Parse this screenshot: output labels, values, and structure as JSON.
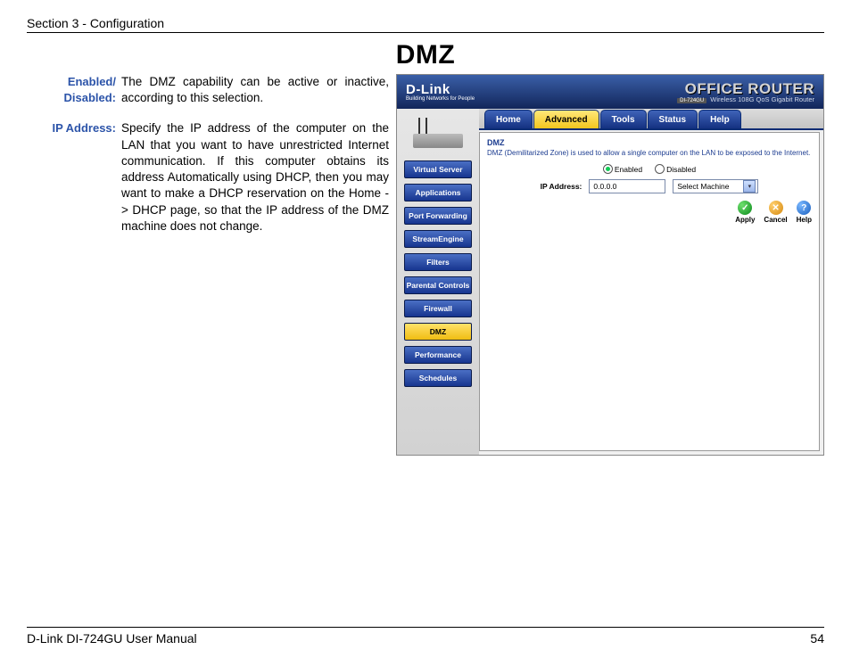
{
  "header": {
    "section": "Section 3 - Configuration"
  },
  "title": "DMZ",
  "descriptions": [
    {
      "label": "Enabled/ Disabled:",
      "text": "The DMZ capability can be active or inactive, according to this selection."
    },
    {
      "label": "IP Address:",
      "text": "Specify the IP address of the computer on the LAN that you want to have unrestricted Internet communication. If this computer obtains its address Automatically using DHCP, then you may want to make a DHCP reservation on the Home -> DHCP page, so that the IP address of the DMZ machine does not change."
    }
  ],
  "router_ui": {
    "brand": "D-Link",
    "brand_tag": "Building Networks for People",
    "product": "OFFICE ROUTER",
    "product_model": "DI-724GU",
    "product_desc": "Wireless 108G QoS Gigabit Router",
    "tabs": [
      "Home",
      "Advanced",
      "Tools",
      "Status",
      "Help"
    ],
    "tabs_active_index": 1,
    "side_nav": [
      "Virtual Server",
      "Applications",
      "Port Forwarding",
      "StreamEngine",
      "Filters",
      "Parental Controls",
      "Firewall",
      "DMZ",
      "Performance",
      "Schedules"
    ],
    "side_nav_active_index": 7,
    "panel": {
      "title": "DMZ",
      "desc": "DMZ (Demilitarized Zone) is used to allow a single computer on the LAN to be exposed to the Internet.",
      "radio": {
        "enabled": "Enabled",
        "disabled": "Disabled",
        "selected": "enabled"
      },
      "ip_label": "IP Address:",
      "ip_value": "0.0.0.0",
      "select_value": "Select Machine",
      "actions": {
        "apply": "Apply",
        "cancel": "Cancel",
        "help": "Help"
      }
    }
  },
  "footer": {
    "manual": "D-Link DI-724GU User Manual",
    "page": "54"
  }
}
